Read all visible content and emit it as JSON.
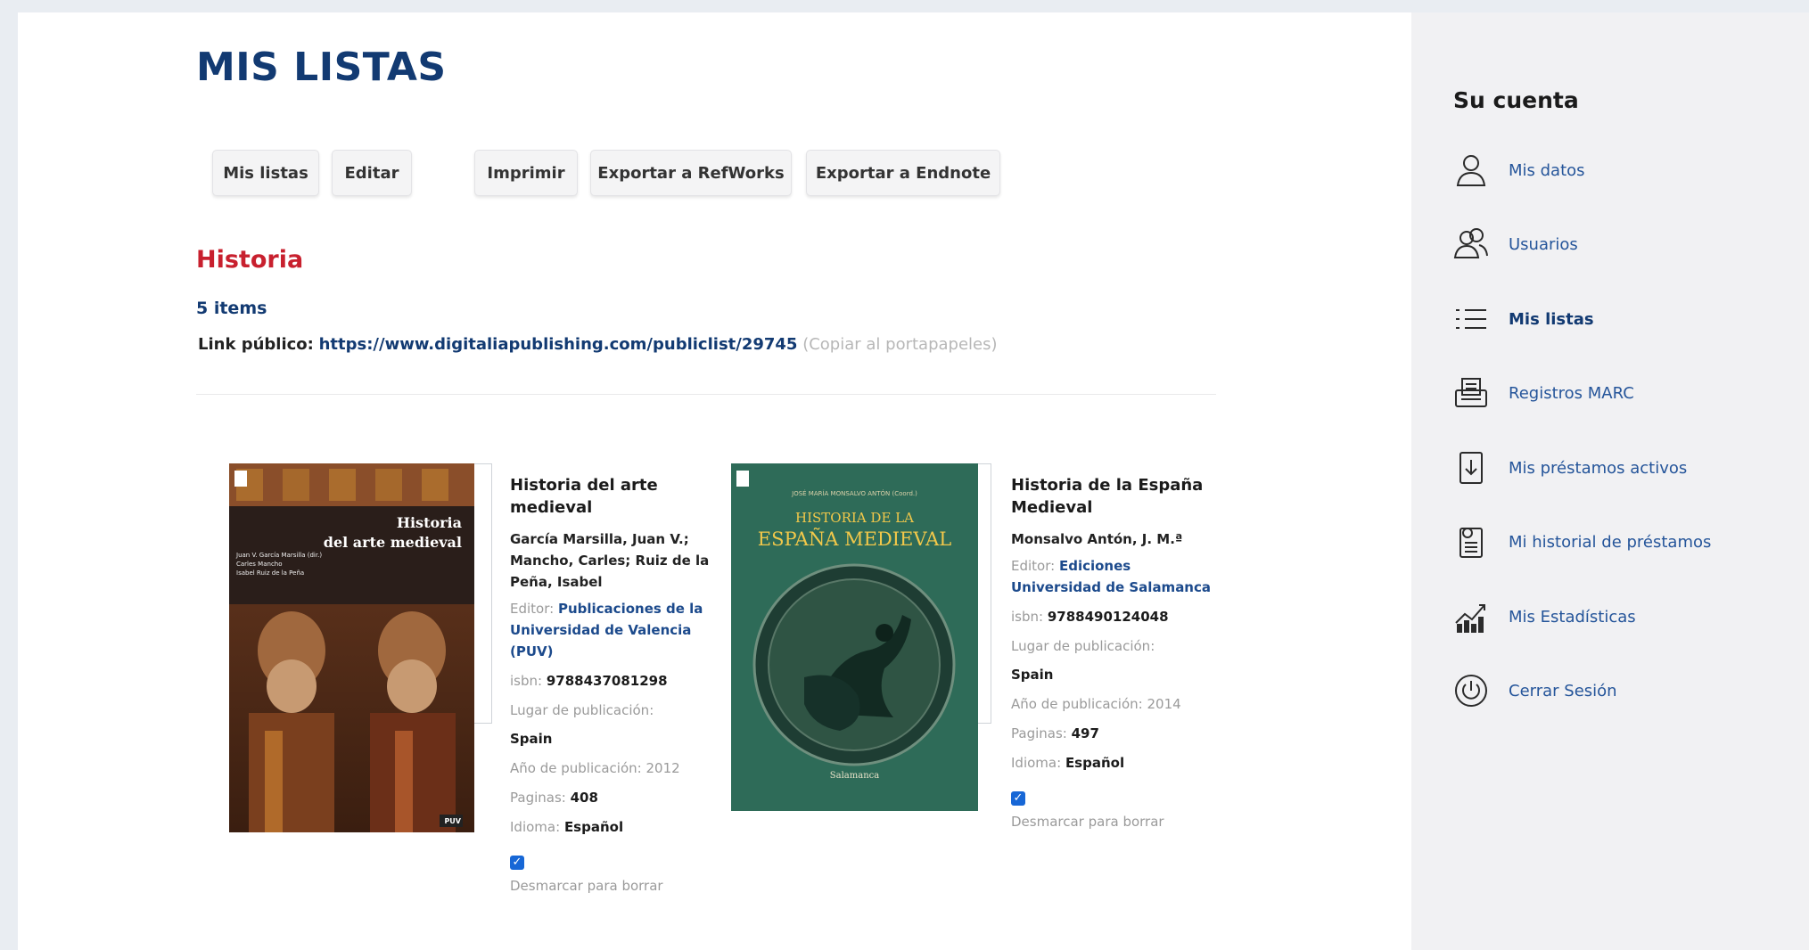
{
  "page": {
    "title": "MIS LISTAS"
  },
  "toolbar": {
    "mis_listas": "Mis listas",
    "editar": "Editar",
    "imprimir": "Imprimir",
    "exportar_refworks": "Exportar a RefWorks",
    "exportar_endnote": "Exportar a Endnote"
  },
  "list": {
    "name": "Historia",
    "count": "5 items",
    "link_label": "Link público:",
    "link_url": "https://www.digitaliapublishing.com/publiclist/29745",
    "copy_label": "(Copiar al portapapeles)"
  },
  "books": [
    {
      "title": "Historia del arte medieval",
      "authors": "García Marsilla, Juan V.; Mancho, Carles; Ruiz de la Peña, Isabel",
      "editor_label": "Editor:",
      "editor": "Publicaciones de la Universidad de Valencia (PUV)",
      "isbn_label": "isbn:",
      "isbn": "9788437081298",
      "place_label": "Lugar de publicación:",
      "place": "Spain",
      "year_label": "Año de publicación:",
      "year": "2012",
      "pages_label": "Paginas:",
      "pages": "408",
      "lang_label": "Idioma:",
      "lang": "Español",
      "checkbox_label": "Desmarcar para borrar",
      "cover": {
        "title_line1": "Historia",
        "title_line2": "del arte medieval",
        "authors_line1": "Juan V. García Marsilla (dir.)",
        "authors_line2": "Carles Mancho",
        "authors_line3": "Isabel Ruiz de la Peña",
        "publisher_mark": "PUV"
      }
    },
    {
      "title": "Historia de la España Medieval",
      "authors": "Monsalvo Antón, J. M.ª",
      "editor_label": "Editor:",
      "editor": "Ediciones Universidad de Salamanca",
      "isbn_label": "isbn:",
      "isbn": "9788490124048",
      "place_label": "Lugar de publicación:",
      "place": "Spain",
      "year_label": "Año de publicación:",
      "year": "2014",
      "pages_label": "Paginas:",
      "pages": "497",
      "lang_label": "Idioma:",
      "lang": "Español",
      "checkbox_label": "Desmarcar para borrar",
      "cover": {
        "author_line": "JOSÉ MARÍA MONSALVO ANTÓN (Coord.)",
        "title_line1": "HISTORIA DE LA",
        "title_line2": "ESPAÑA MEDIEVAL",
        "publisher_mark": "Salamanca"
      }
    }
  ],
  "sidebar": {
    "title": "Su cuenta",
    "items": [
      {
        "label": "Mis datos",
        "icon": "user-icon"
      },
      {
        "label": "Usuarios",
        "icon": "users-icon"
      },
      {
        "label": "Mis listas",
        "icon": "list-icon",
        "active": true
      },
      {
        "label": "Registros MARC",
        "icon": "marc-records-icon"
      },
      {
        "label": "Mis préstamos activos",
        "icon": "active-loans-icon"
      },
      {
        "label": "Mi historial de préstamos",
        "icon": "loan-history-icon"
      },
      {
        "label": "Mis Estadísticas",
        "icon": "statistics-icon"
      },
      {
        "label": "Cerrar Sesión",
        "icon": "power-icon"
      }
    ]
  },
  "colors": {
    "title_blue": "#123a72",
    "link_blue": "#25559a",
    "list_red": "#c8202e",
    "cover_green": "#2e6b58"
  }
}
